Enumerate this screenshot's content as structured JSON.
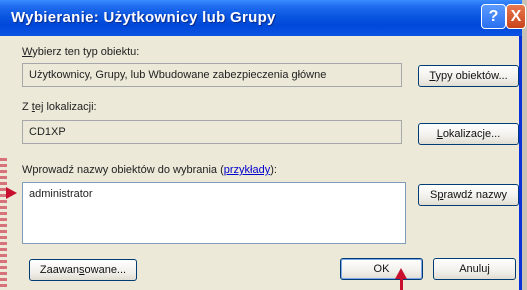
{
  "window": {
    "title": "Wybieranie: Użytkownicy lub Grupy",
    "help_glyph": "?",
    "close_glyph": "X"
  },
  "object_type": {
    "label_first": "W",
    "label_rest": "ybierz ten typ obiektu:",
    "value": "Użytkownicy, Grupy, lub Wbudowane zabezpieczenia główne",
    "button_prefix": "",
    "button_accel": "T",
    "button_rest": "ypy obiektów..."
  },
  "location": {
    "label_prefix": "Z ",
    "label_accel": "t",
    "label_rest": "ej lokalizacji:",
    "value": "CD1XP",
    "button_prefix": "",
    "button_accel": "L",
    "button_rest": "okalizacje..."
  },
  "object_names": {
    "label_text": "Wprowadź nazwy obiektów do wybrania (",
    "link_text": "przykłady",
    "label_end": "):",
    "value": "administrator",
    "check_prefix": "S",
    "check_accel": "p",
    "check_rest": "rawdź nazwy"
  },
  "footer": {
    "advanced_prefix": "Zaawan",
    "advanced_accel": "s",
    "advanced_rest": "owane...",
    "ok_label": "OK",
    "cancel_label": "Anuluj"
  }
}
